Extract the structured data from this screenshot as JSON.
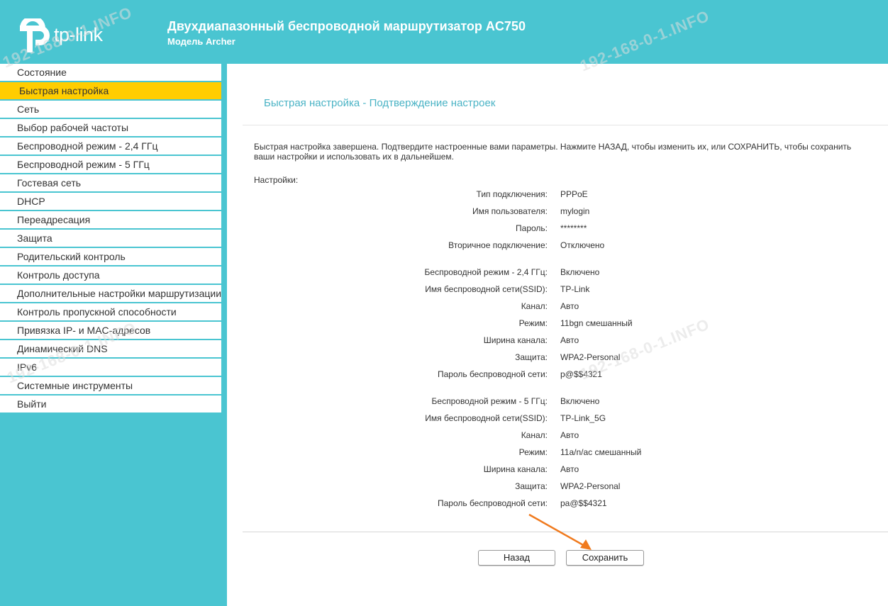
{
  "header": {
    "logo_text": "tp-link",
    "title": "Двухдиапазонный беспроводной маршрутизатор AC750",
    "model": "Модель Archer"
  },
  "sidebar": {
    "items": [
      {
        "label": "Состояние"
      },
      {
        "label": "Быстрая настройка",
        "active": true
      },
      {
        "label": "Сеть"
      },
      {
        "label": "Выбор рабочей частоты"
      },
      {
        "label": "Беспроводной режим - 2,4 ГГц"
      },
      {
        "label": "Беспроводной режим - 5 ГГц"
      },
      {
        "label": "Гостевая сеть"
      },
      {
        "label": "DHCP"
      },
      {
        "label": "Переадресация"
      },
      {
        "label": "Защита"
      },
      {
        "label": "Родительский контроль"
      },
      {
        "label": "Контроль доступа"
      },
      {
        "label": "Дополнительные настройки маршрутизации"
      },
      {
        "label": "Контроль пропускной способности"
      },
      {
        "label": "Привязка IP- и MAC-адресов"
      },
      {
        "label": "Динамический DNS"
      },
      {
        "label": "IPv6"
      },
      {
        "label": "Системные инструменты"
      },
      {
        "label": "Выйти"
      }
    ]
  },
  "main": {
    "title": "Быстрая настройка - Подтверждение настроек",
    "intro": "Быстрая настройка завершена. Подтвердите настроенные вами параметры. Нажмите НАЗАД, чтобы изменить их, или СОХРАНИТЬ, чтобы сохранить ваши настройки и использовать их в дальнейшем.",
    "settings_label": "Настройки:",
    "wan": [
      {
        "key": "Тип подключения:",
        "value": "PPPoE"
      },
      {
        "key": "Имя пользователя:",
        "value": "mylogin"
      },
      {
        "key": "Пароль:",
        "value": "********"
      },
      {
        "key": "Вторичное подключение:",
        "value": "Отключено"
      }
    ],
    "wifi24": [
      {
        "key": "Беспроводной режим - 2,4 ГГц:",
        "value": "Включено"
      },
      {
        "key": "Имя беспроводной сети(SSID):",
        "value": "TP-Link"
      },
      {
        "key": "Канал:",
        "value": "Авто"
      },
      {
        "key": "Режим:",
        "value": "11bgn смешанный"
      },
      {
        "key": "Ширина канала:",
        "value": "Авто"
      },
      {
        "key": "Защита:",
        "value": "WPA2-Personal"
      },
      {
        "key": "Пароль беспроводной сети:",
        "value": "p@$$4321"
      }
    ],
    "wifi5": [
      {
        "key": "Беспроводной режим - 5 ГГц:",
        "value": "Включено"
      },
      {
        "key": "Имя беспроводной сети(SSID):",
        "value": "TP-Link_5G"
      },
      {
        "key": "Канал:",
        "value": "Авто"
      },
      {
        "key": "Режим:",
        "value": "11a/n/ac смешанный"
      },
      {
        "key": "Ширина канала:",
        "value": "Авто"
      },
      {
        "key": "Защита:",
        "value": "WPA2-Personal"
      },
      {
        "key": "Пароль беспроводной сети:",
        "value": "pa@$$4321"
      }
    ],
    "buttons": {
      "back": "Назад",
      "save": "Сохранить"
    }
  },
  "watermark": "192-168-0-1.INFO",
  "colors": {
    "accent": "#4ac5d1",
    "active": "#ffcd00",
    "title": "#4ab3c5",
    "arrow": "#f07a1e"
  }
}
